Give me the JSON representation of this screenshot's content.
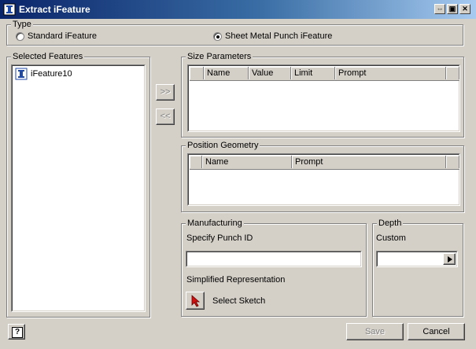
{
  "window": {
    "title": "Extract iFeature"
  },
  "type_group": {
    "label": "Type",
    "options": [
      {
        "label": "Standard iFeature",
        "selected": false
      },
      {
        "label": "Sheet Metal Punch iFeature",
        "selected": true
      }
    ]
  },
  "selected_features": {
    "label": "Selected Features",
    "items": [
      {
        "label": "iFeature10",
        "icon": "ifeature-icon"
      }
    ]
  },
  "transfer": {
    "add_label": ">>",
    "remove_label": "<<"
  },
  "size_parameters": {
    "label": "Size Parameters",
    "columns": [
      "Name",
      "Value",
      "Limit",
      "Prompt"
    ],
    "rows": []
  },
  "position_geometry": {
    "label": "Position Geometry",
    "columns": [
      "Name",
      "Prompt"
    ],
    "rows": []
  },
  "manufacturing": {
    "label": "Manufacturing",
    "punch_id_label": "Specify Punch ID",
    "punch_id_value": "",
    "simplified_label": "Simplified Representation",
    "select_sketch_label": "Select Sketch"
  },
  "depth": {
    "label": "Depth",
    "custom_label": "Custom",
    "value": ""
  },
  "footer": {
    "save_label": "Save",
    "cancel_label": "Cancel",
    "help_label": "?"
  },
  "colors": {
    "titlebar_start": "#0a246a",
    "titlebar_end": "#a6caf0",
    "dialog_bg": "#d4d0c8"
  }
}
